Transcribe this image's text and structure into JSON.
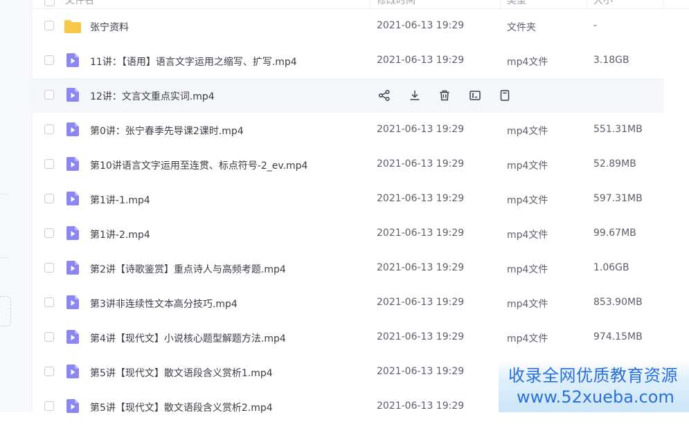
{
  "header": {
    "name_label": "文件名",
    "date_label": "修改时间",
    "type_label": "类型",
    "size_label": "大小"
  },
  "rows": [
    {
      "kind": "folder",
      "name": "张宁资料",
      "date": "2021-06-13 19:29",
      "type": "文件夹",
      "size": "-"
    },
    {
      "kind": "video",
      "name": "11讲：【语用】语言文字运用之缩写、扩写.mp4",
      "date": "2021-06-13 19:29",
      "type": "mp4文件",
      "size": "3.18GB"
    },
    {
      "kind": "video",
      "name": "12讲：文言文重点实词.mp4",
      "date": "",
      "type": "",
      "size": "",
      "hovered": true
    },
    {
      "kind": "video",
      "name": "第0讲：张宁春季先导课2课时.mp4",
      "date": "2021-06-13 19:29",
      "type": "mp4文件",
      "size": "551.31MB"
    },
    {
      "kind": "video",
      "name": "第10讲语言文字运用至连贯、标点符号-2_ev.mp4",
      "date": "2021-06-13 19:29",
      "type": "mp4文件",
      "size": "52.89MB"
    },
    {
      "kind": "video",
      "name": "第1讲-1.mp4",
      "date": "2021-06-13 19:29",
      "type": "mp4文件",
      "size": "597.31MB"
    },
    {
      "kind": "video",
      "name": "第1讲-2.mp4",
      "date": "2021-06-13 19:29",
      "type": "mp4文件",
      "size": "99.67MB"
    },
    {
      "kind": "video",
      "name": "第2讲【诗歌鉴赏】重点诗人与高频考题.mp4",
      "date": "2021-06-13 19:29",
      "type": "mp4文件",
      "size": "1.06GB"
    },
    {
      "kind": "video",
      "name": "第3讲非连续性文本高分技巧.mp4",
      "date": "2021-06-13 19:29",
      "type": "mp4文件",
      "size": "853.90MB"
    },
    {
      "kind": "video",
      "name": "第4讲【现代文】小说核心题型解题方法.mp4",
      "date": "2021-06-13 19:29",
      "type": "mp4文件",
      "size": "974.15MB"
    },
    {
      "kind": "video",
      "name": "第5讲【现代文】散文语段含义赏析1.mp4",
      "date": "2021-06-13 19:29",
      "type": "",
      "size": ""
    },
    {
      "kind": "video",
      "name": "第5讲【现代文】散文语段含义赏析2.mp4",
      "date": "2021-06-13 19:29",
      "type": "",
      "size": ""
    }
  ],
  "hover_actions": [
    "share-icon",
    "download-icon",
    "delete-icon",
    "rename-icon",
    "copy-icon"
  ],
  "watermark": {
    "line1": "收录全网优质教育资源",
    "line2": "www.52xueba.com"
  },
  "colors": {
    "folder": "#f7c948",
    "video": "#8b86f2",
    "accent": "#2a6fdc"
  }
}
